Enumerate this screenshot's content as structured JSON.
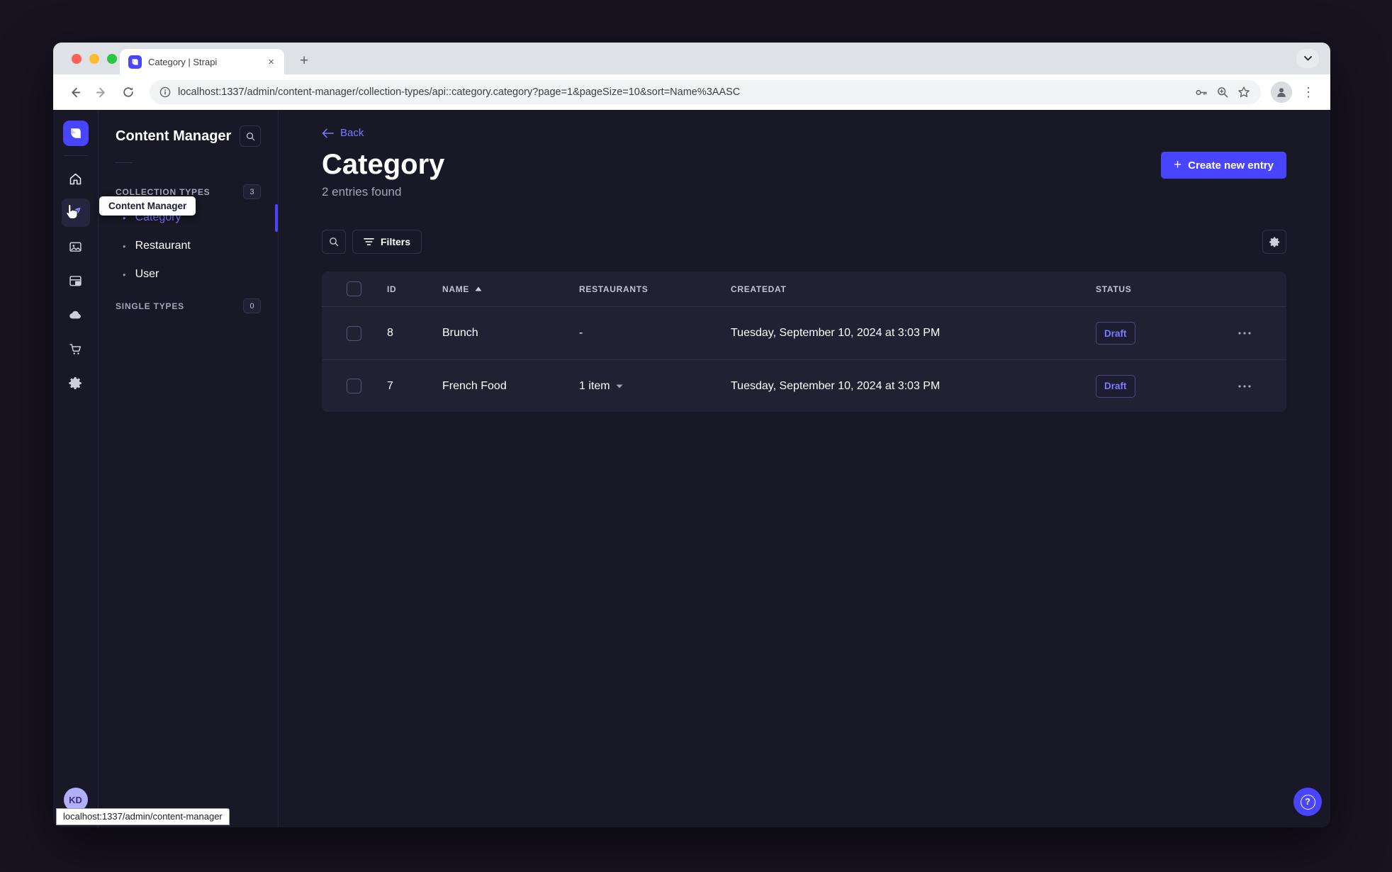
{
  "browser": {
    "tab_title": "Category | Strapi",
    "url": "localhost:1337/admin/content-manager/collection-types/api::category.category?page=1&pageSize=10&sort=Name%3AASC",
    "traffic_light_colors": [
      "#ff5f57",
      "#febc2e",
      "#28c840"
    ]
  },
  "icons": {
    "plus": "+",
    "close": "×",
    "dots_vertical": "⋮",
    "question": "?",
    "bullet": "•"
  },
  "rail": {
    "tooltip": "Content Manager",
    "avatar_initials": "KD"
  },
  "subnav": {
    "title": "Content Manager",
    "collection_types": {
      "label": "COLLECTION TYPES",
      "badge": "3",
      "items": [
        {
          "label": "Category",
          "active": true
        },
        {
          "label": "Restaurant",
          "active": false
        },
        {
          "label": "User",
          "active": false
        }
      ]
    },
    "single_types": {
      "label": "SINGLE TYPES",
      "badge": "0"
    }
  },
  "main": {
    "back_label": "Back",
    "title": "Category",
    "subtitle": "2 entries found",
    "create_button_label": "Create new entry",
    "filters_button_label": "Filters",
    "table": {
      "headers": {
        "id": "ID",
        "name": "NAME",
        "restaurants": "RESTAURANTS",
        "created_at": "CREATEDAT",
        "status": "STATUS"
      },
      "rows": [
        {
          "id": "8",
          "name": "Brunch",
          "restaurants": "-",
          "created_at": "Tuesday, September 10, 2024 at 3:03 PM",
          "status": "Draft"
        },
        {
          "id": "7",
          "name": "French Food",
          "restaurants": "1 item",
          "created_at": "Tuesday, September 10, 2024 at 3:03 PM",
          "status": "Draft"
        }
      ]
    }
  },
  "status_bar": {
    "text": "localhost:1337/admin/content-manager"
  },
  "colors": {
    "accent": "#4945ff",
    "accent_light": "#7b79ff",
    "app_background": "#181826",
    "surface": "#212134",
    "border": "#32324d",
    "text_muted": "#a5a5ba",
    "desktop": "#171320"
  }
}
